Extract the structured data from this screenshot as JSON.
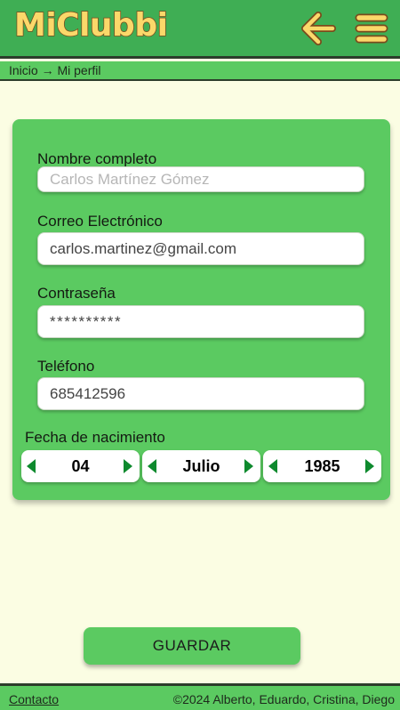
{
  "header": {
    "logo": "MiClubbi"
  },
  "breadcrumb": {
    "text": "Inicio → Mi perfil"
  },
  "form": {
    "name_label": "Nombre completo",
    "name_placeholder": "Carlos Martínez Gómez",
    "email_label": "Correo Electrónico",
    "email_value": "carlos.martinez@gmail.com",
    "password_label": "Contraseña",
    "password_value": "**********",
    "phone_label": "Teléfono",
    "phone_value": "685412596",
    "birth_label": "Fecha de nacimiento",
    "birth_day": "04",
    "birth_month": "Julio",
    "birth_year": "1985"
  },
  "actions": {
    "save_label": "GUARDAR"
  },
  "footer": {
    "contact_label": "Contacto",
    "copyright": "©2024 Alberto, Eduardo, Cristina, Diego"
  },
  "colors": {
    "header_bg": "#3fae54",
    "panel_green": "#5bca61",
    "page_bg": "#fbfde3",
    "logo_fill": "#fbd86a",
    "arrow_green": "#0e8a2e"
  }
}
